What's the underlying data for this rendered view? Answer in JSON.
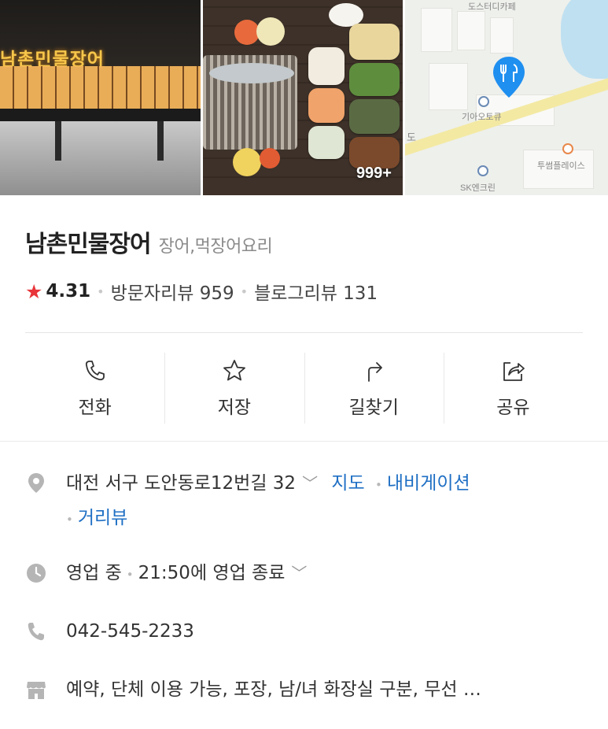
{
  "photos": {
    "sign_text": "남촌민물장어",
    "photo_count_badge": "999+",
    "map_labels": [
      "도스터디카페",
      "기아오토큐",
      "투썸플레이스",
      "SK엔크린",
      "도"
    ]
  },
  "place": {
    "name": "남촌민물장어",
    "category": "장어,먹장어요리",
    "rating": "4.31",
    "visitor_reviews": "방문자리뷰 959",
    "blog_reviews": "블로그리뷰 131"
  },
  "actions": [
    {
      "label": "전화",
      "icon": "phone-icon"
    },
    {
      "label": "저장",
      "icon": "star-outline-icon"
    },
    {
      "label": "길찾기",
      "icon": "directions-icon"
    },
    {
      "label": "공유",
      "icon": "share-icon"
    }
  ],
  "address": {
    "text": "대전 서구 도안동로12번길 32",
    "map_link": "지도",
    "navigation_link": "내비게이션",
    "street_view_link": "거리뷰"
  },
  "hours": {
    "status": "영업 중",
    "close_time": "21:50에 영업 종료"
  },
  "phone": {
    "number": "042-545-2233"
  },
  "amenities": {
    "text": "예약, 단체 이용 가능, 포장, 남/녀 화장실 구분, 무선 …"
  },
  "colors": {
    "accent_link": "#1f6fc4",
    "star": "#e8353a",
    "map_pin": "#1f8ff0"
  }
}
